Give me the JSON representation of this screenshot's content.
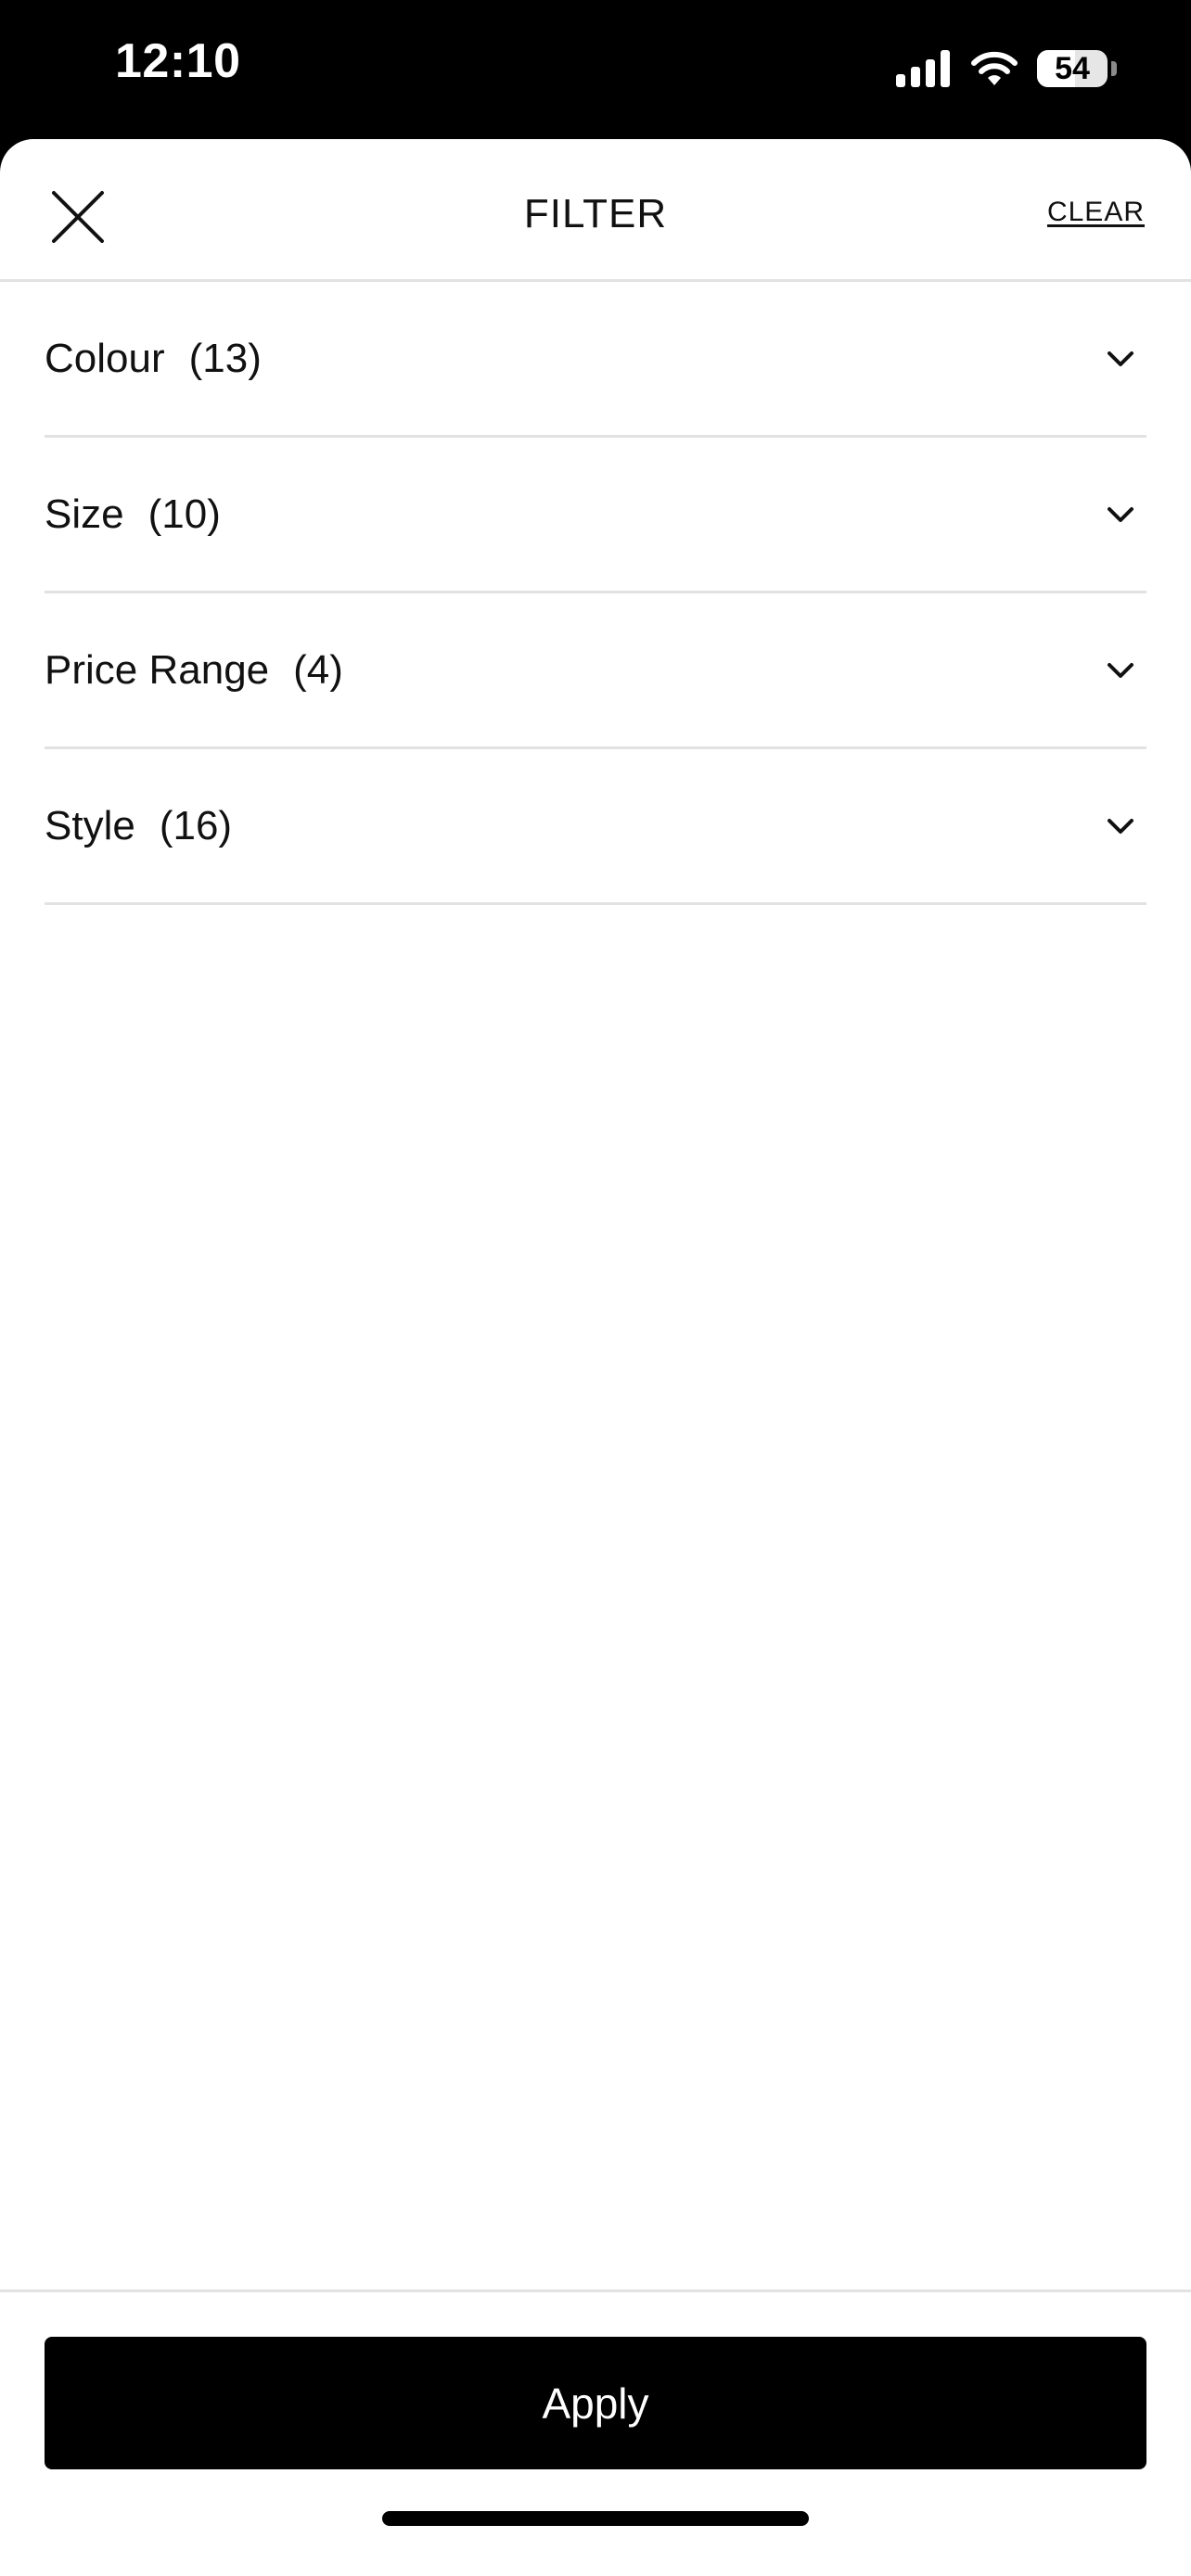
{
  "status_bar": {
    "time": "12:10",
    "battery": "54",
    "battery_level": 0.54,
    "icons": [
      "signal-icon",
      "wifi-icon",
      "battery-icon"
    ]
  },
  "header": {
    "title": "FILTER",
    "clear_label": "CLEAR",
    "close_icon": "close-icon"
  },
  "filters": [
    {
      "name": "Colour",
      "count": "(13)",
      "icon": "chevron-down-icon"
    },
    {
      "name": "Size",
      "count": "(10)",
      "icon": "chevron-down-icon"
    },
    {
      "name": "Price Range",
      "count": "(4)",
      "icon": "chevron-down-icon"
    },
    {
      "name": "Style",
      "count": "(16)",
      "icon": "chevron-down-icon"
    }
  ],
  "footer": {
    "apply_label": "Apply"
  },
  "colors": {
    "primary": "#000000",
    "background": "#ffffff",
    "divider": "#e2e2e2",
    "text": "#111111"
  }
}
